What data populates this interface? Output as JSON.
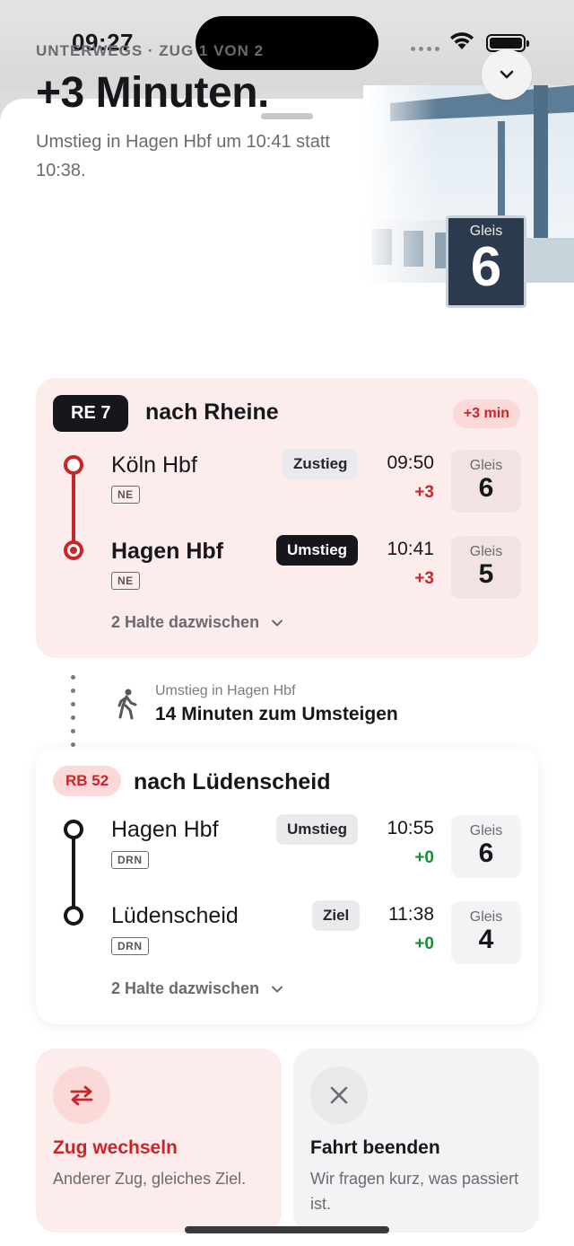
{
  "status_bar": {
    "time": "09:27"
  },
  "header": {
    "eyebrow": "UNTERWEGS · ZUG 1 VON 2",
    "title": "+3 Minuten.",
    "subtitle": "Umstieg in Hagen Hbf um 10:41 statt 10:38."
  },
  "illustration": {
    "sign_label": "Gleis",
    "sign_number": "6"
  },
  "leg1": {
    "line": "RE 7",
    "destination": "nach Rheine",
    "delay": "+3 min",
    "stops": [
      {
        "name": "Köln Hbf",
        "operator": "NE",
        "role": "Zustieg",
        "time": "09:50",
        "delta": "+3",
        "platform_label": "Gleis",
        "platform": "6"
      },
      {
        "name": "Hagen Hbf",
        "operator": "NE",
        "role": "Umstieg",
        "time": "10:41",
        "delta": "+3",
        "platform_label": "Gleis",
        "platform": "5"
      }
    ],
    "halts": "2 Halte dazwischen"
  },
  "transfer": {
    "caption": "Umstieg in Hagen Hbf",
    "main": "14 Minuten zum Umsteigen"
  },
  "leg2": {
    "line": "RB 52",
    "destination": "nach Lüdenscheid",
    "stops": [
      {
        "name": "Hagen Hbf",
        "operator": "DRN",
        "role": "Umstieg",
        "time": "10:55",
        "delta": "+0",
        "platform_label": "Gleis",
        "platform": "6"
      },
      {
        "name": "Lüdenscheid",
        "operator": "DRN",
        "role": "Ziel",
        "time": "11:38",
        "delta": "+0",
        "platform_label": "Gleis",
        "platform": "4"
      }
    ],
    "halts": "2 Halte dazwischen"
  },
  "actions": {
    "switch": {
      "title": "Zug wechseln",
      "desc": "Anderer Zug, gleiches Ziel."
    },
    "end": {
      "title": "Fahrt beenden",
      "desc": "Wir fragen kurz, was passiert ist."
    }
  },
  "colors": {
    "accent_red": "#c8252a",
    "dark": "#16171b",
    "green": "#1b8a3a",
    "card_pink": "#fdecec"
  },
  "icons": [
    "chevron-down-icon",
    "walk-icon",
    "swap-icon",
    "close-icon",
    "wifi-icon",
    "battery-icon"
  ]
}
